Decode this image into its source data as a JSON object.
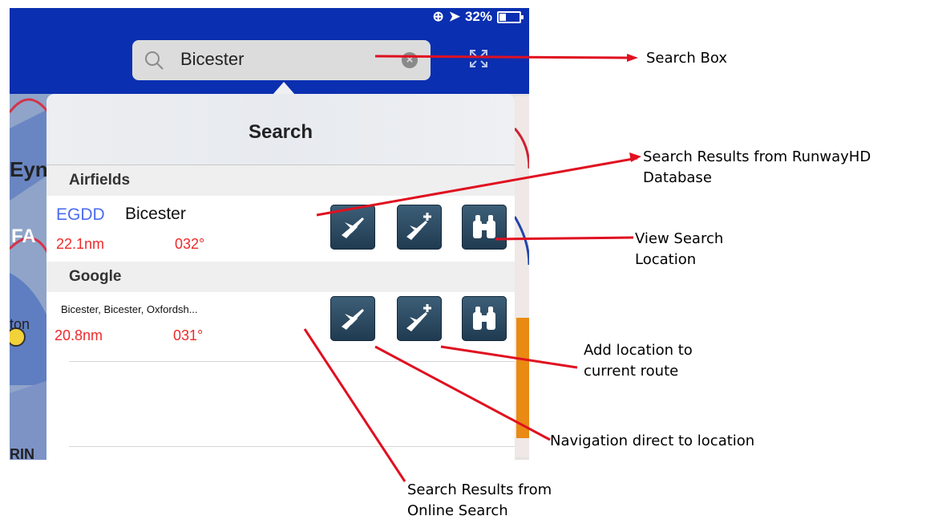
{
  "status": {
    "battery_percent": "32%"
  },
  "search": {
    "value": "Bicester"
  },
  "panel": {
    "title": "Search",
    "sections": [
      {
        "header": "Airfields",
        "result": {
          "code": "EGDD",
          "name": "Bicester",
          "distance": "22.1nm",
          "bearing": "032°"
        }
      },
      {
        "header": "Google",
        "result": {
          "name": "Bicester, Bicester, Oxfordsh...",
          "distance": "20.8nm",
          "bearing": "031°"
        }
      }
    ],
    "action_icons": [
      "plane-direct-icon",
      "plane-add-icon",
      "binoculars-icon"
    ]
  },
  "annotations": {
    "search_box": "Search Box",
    "runway_results_1": "Search Results from RunwayHD",
    "runway_results_2": "Database",
    "view_location_1": "View Search",
    "view_location_2": "Location",
    "add_route_1": "Add location to",
    "add_route_2": "current route",
    "nav_direct": "Navigation direct to location",
    "online_results_1": "Search Results from",
    "online_results_2": "Online Search"
  },
  "colors": {
    "top_bar": "#0a2fb0",
    "code_blue": "#4a6cf0",
    "distance_red": "#ef2a2a",
    "annotation_line": "#e01020"
  }
}
